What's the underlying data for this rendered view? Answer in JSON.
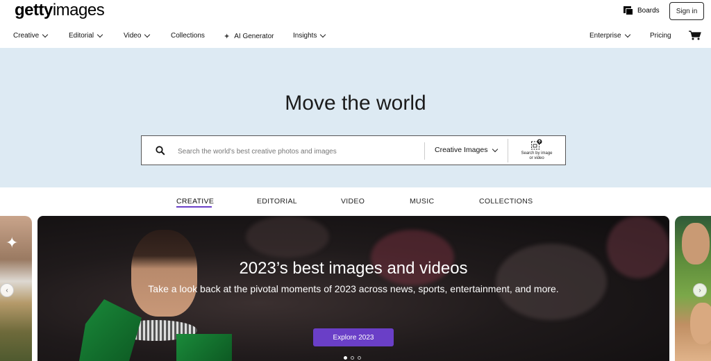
{
  "header": {
    "logo_bold": "getty",
    "logo_light": "images",
    "boards_label": "Boards",
    "signin_label": "Sign in"
  },
  "nav": {
    "items": [
      {
        "label": "Creative"
      },
      {
        "label": "Editorial"
      },
      {
        "label": "Video"
      },
      {
        "label": "Collections"
      },
      {
        "label": "AI Generator"
      },
      {
        "label": "Insights"
      }
    ],
    "enterprise_label": "Enterprise",
    "pricing_label": "Pricing"
  },
  "hero": {
    "title": "Move the world",
    "search_placeholder": "Search the world's best creative photos and images",
    "search_type": "Creative Images",
    "image_search_line1": "Search by image",
    "image_search_line2": "or video"
  },
  "tabs": [
    {
      "label": "CREATIVE",
      "active": true
    },
    {
      "label": "EDITORIAL"
    },
    {
      "label": "VIDEO"
    },
    {
      "label": "MUSIC"
    },
    {
      "label": "COLLECTIONS"
    }
  ],
  "featured": {
    "title": "2023’s best images and videos",
    "subtitle": "Take a look back at the pivotal moments of 2023 across news, sports, entertainment, and more.",
    "button_label": "Explore 2023",
    "slide_count": 3,
    "active_slide": 1
  },
  "colors": {
    "accent": "#6a3fc7",
    "hero_bg": "#ddeaf3"
  }
}
